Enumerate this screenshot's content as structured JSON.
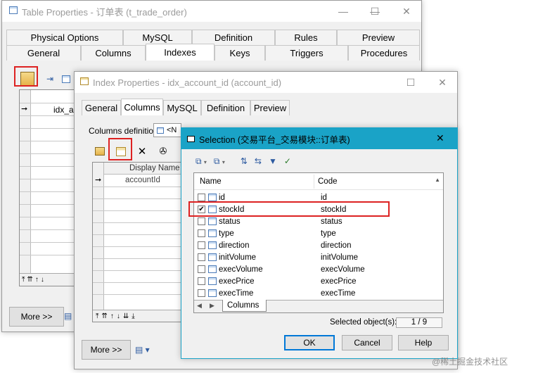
{
  "table_window": {
    "title": "Table Properties - 订单表 (t_trade_order)",
    "tabs_row1": [
      "Physical Options",
      "MySQL",
      "Definition",
      "Rules",
      "Preview"
    ],
    "tabs_row2": [
      "General",
      "Columns",
      "Indexes",
      "Keys",
      "Triggers",
      "Procedures"
    ],
    "active_tab": "Indexes",
    "index_row": "idx_ac",
    "more_label": "More >>"
  },
  "index_window": {
    "title": "Index Properties - idx_account_id (account_id)",
    "tabs": [
      "General",
      "Columns",
      "MySQL",
      "Definition",
      "Preview"
    ],
    "active_tab": "Columns",
    "columns_def_label": "Columns definition:",
    "columns_def_value": "<N",
    "grid_header": "Display Name",
    "grid_row": "accountId",
    "more_label": "More >>"
  },
  "selection_window": {
    "title": "Selection (交易平台_交易模块::订单表)",
    "headers": {
      "name": "Name",
      "code": "Code"
    },
    "rows": [
      {
        "name": "id",
        "code": "id",
        "checked": false
      },
      {
        "name": "stockId",
        "code": "stockId",
        "checked": true
      },
      {
        "name": "status",
        "code": "status",
        "checked": false
      },
      {
        "name": "type",
        "code": "type",
        "checked": false
      },
      {
        "name": "direction",
        "code": "direction",
        "checked": false
      },
      {
        "name": "initVolume",
        "code": "initVolume",
        "checked": false
      },
      {
        "name": "execVolume",
        "code": "execVolume",
        "checked": false
      },
      {
        "name": "execPrice",
        "code": "execPrice",
        "checked": false
      },
      {
        "name": "execTime",
        "code": "execTime",
        "checked": false
      }
    ],
    "sheet_tab": "Columns",
    "selected_label": "Selected object(s):",
    "selected_count": "1 / 9",
    "ok_label": "OK",
    "cancel_label": "Cancel",
    "help_label": "Help"
  },
  "watermark": "@稀土掘金技术社区"
}
